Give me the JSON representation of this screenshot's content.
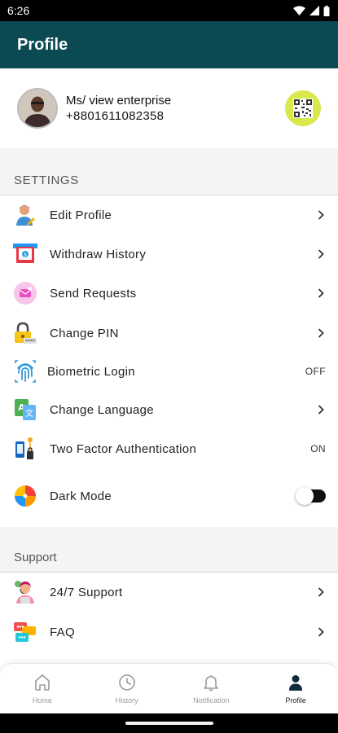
{
  "status_bar": {
    "time": "6:26"
  },
  "header": {
    "title": "Profile"
  },
  "profile": {
    "name": "Ms/ view enterprise",
    "phone": "+8801611082358"
  },
  "settings": {
    "title": "SETTINGS",
    "items": [
      {
        "label": "Edit Profile",
        "icon": "user-edit-icon"
      },
      {
        "label": "Withdraw History",
        "icon": "atm-icon"
      },
      {
        "label": "Send Requests",
        "icon": "message-icon"
      },
      {
        "label": "Change PIN",
        "icon": "lock-pin-icon"
      },
      {
        "label": "Biometric Login",
        "icon": "fingerprint-icon",
        "value": "OFF"
      },
      {
        "label": "Change Language",
        "icon": "language-icon"
      },
      {
        "label": "Two Factor Authentication",
        "icon": "two-factor-icon",
        "value": "ON"
      },
      {
        "label": "Dark Mode",
        "icon": "theme-icon",
        "toggle_on": false
      }
    ]
  },
  "support": {
    "title": "Support",
    "items": [
      {
        "label": "24/7 Support",
        "icon": "support-agent-icon"
      },
      {
        "label": "FAQ",
        "icon": "faq-icon"
      }
    ]
  },
  "bottom_nav": {
    "items": [
      {
        "label": "Home",
        "icon": "home-icon",
        "active": false
      },
      {
        "label": "History",
        "icon": "clock-icon",
        "active": false
      },
      {
        "label": "Notification",
        "icon": "bell-icon",
        "active": false
      },
      {
        "label": "Profile",
        "icon": "person-icon",
        "active": true
      }
    ]
  },
  "colors": {
    "header_bg": "#0b4a52",
    "qr_bg": "#d9e84a",
    "nav_inactive": "#9a9a9a"
  }
}
